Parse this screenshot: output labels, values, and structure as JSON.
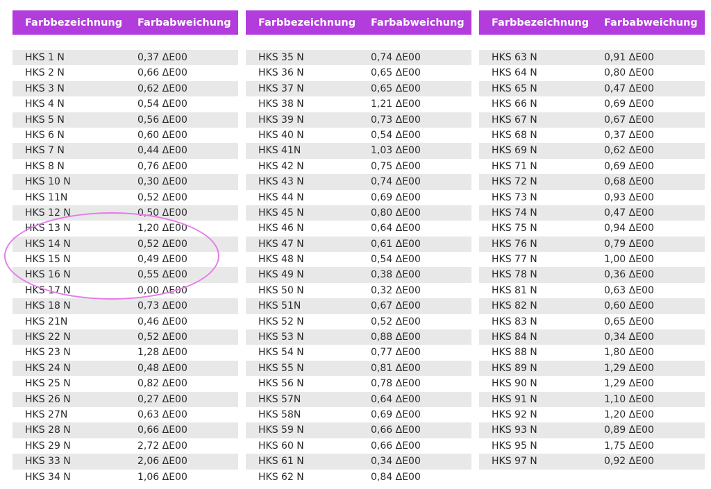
{
  "tables": [
    {
      "header": {
        "name": "Farbbezeichnung",
        "deviation": "Farbabweichung"
      },
      "rows": [
        [
          "HKS 1 N",
          "0,37 ΔE00"
        ],
        [
          "HKS 2 N",
          "0,66 ΔE00"
        ],
        [
          "HKS 3 N",
          "0,62 ΔE00"
        ],
        [
          "HKS 4 N",
          "0,54 ΔE00"
        ],
        [
          "HKS 5 N",
          "0,56 ΔE00"
        ],
        [
          "HKS 6 N",
          "0,60 ΔE00"
        ],
        [
          "HKS 7 N",
          "0,44 ΔE00"
        ],
        [
          "HKS 8 N",
          "0,76 ΔE00"
        ],
        [
          "HKS 10 N",
          "0,30 ΔE00"
        ],
        [
          "HKS 11N",
          "0,52 ΔE00"
        ],
        [
          "HKS 12 N",
          "0,50 ΔE00"
        ],
        [
          "HKS 13 N",
          "1,20 ΔE00"
        ],
        [
          "HKS 14 N",
          "0,52 ΔE00"
        ],
        [
          "HKS 15 N",
          "0,49 ΔE00"
        ],
        [
          "HKS 16 N",
          "0,55 ΔE00"
        ],
        [
          "HKS 17 N",
          "0,00 ΔE00"
        ],
        [
          "HKS 18 N",
          "0,73 ΔE00"
        ],
        [
          "HKS 21N",
          "0,46 ΔE00"
        ],
        [
          "HKS 22 N",
          "0,52 ΔE00"
        ],
        [
          "HKS 23 N",
          "1,28 ΔE00"
        ],
        [
          "HKS 24 N",
          "0,48 ΔE00"
        ],
        [
          "HKS 25 N",
          "0,82 ΔE00"
        ],
        [
          "HKS 26 N",
          "0,27 ΔE00"
        ],
        [
          "HKS 27N",
          "0,63 ΔE00"
        ],
        [
          "HKS 28 N",
          "0,66 ΔE00"
        ],
        [
          "HKS 29 N",
          "2,72 ΔE00"
        ],
        [
          "HKS 33 N",
          "2,06 ΔE00"
        ],
        [
          "HKS 34 N",
          "1,06 ΔE00"
        ]
      ]
    },
    {
      "header": {
        "name": "Farbbezeichnung",
        "deviation": "Farbabweichung"
      },
      "rows": [
        [
          "HKS 35 N",
          "0,74 ΔE00"
        ],
        [
          "HKS 36 N",
          "0,65 ΔE00"
        ],
        [
          "HKS 37 N",
          "0,65 ΔE00"
        ],
        [
          "HKS 38 N",
          "1,21 ΔE00"
        ],
        [
          "HKS 39 N",
          "0,73 ΔE00"
        ],
        [
          "HKS 40 N",
          "0,54 ΔE00"
        ],
        [
          "HKS 41N",
          "1,03 ΔE00"
        ],
        [
          "HKS 42 N",
          "0,75 ΔE00"
        ],
        [
          "HKS 43 N",
          "0,74 ΔE00"
        ],
        [
          "HKS 44 N",
          "0,69 ΔE00"
        ],
        [
          "HKS 45 N",
          "0,80 ΔE00"
        ],
        [
          "HKS 46 N",
          "0,64 ΔE00"
        ],
        [
          "HKS 47 N",
          "0,61 ΔE00"
        ],
        [
          "HKS 48 N",
          "0,54 ΔE00"
        ],
        [
          "HKS 49 N",
          "0,38 ΔE00"
        ],
        [
          "HKS 50 N",
          "0,32 ΔE00"
        ],
        [
          "HKS 51N",
          "0,67 ΔE00"
        ],
        [
          "HKS 52 N",
          "0,52 ΔE00"
        ],
        [
          "HKS 53 N",
          "0,88 ΔE00"
        ],
        [
          "HKS 54 N",
          "0,77 ΔE00"
        ],
        [
          "HKS 55 N",
          "0,81 ΔE00"
        ],
        [
          "HKS 56 N",
          "0,78 ΔE00"
        ],
        [
          "HKS 57N",
          "0,64 ΔE00"
        ],
        [
          "HKS 58N",
          "0,69 ΔE00"
        ],
        [
          "HKS 59 N",
          "0,66 ΔE00"
        ],
        [
          "HKS 60 N",
          "0,66 ΔE00"
        ],
        [
          "HKS 61 N",
          "0,34 ΔE00"
        ],
        [
          "HKS 62 N",
          "0,84 ΔE00"
        ]
      ]
    },
    {
      "header": {
        "name": "Farbbezeichnung",
        "deviation": "Farbabweichung"
      },
      "rows": [
        [
          "HKS 63 N",
          "0,91 ΔE00"
        ],
        [
          "HKS 64 N",
          "0,80 ΔE00"
        ],
        [
          "HKS 65 N",
          "0,47 ΔE00"
        ],
        [
          "HKS 66 N",
          "0,69 ΔE00"
        ],
        [
          "HKS 67 N",
          "0,67 ΔE00"
        ],
        [
          "HKS 68 N",
          "0,37 ΔE00"
        ],
        [
          "HKS 69 N",
          "0,62 ΔE00"
        ],
        [
          "HKS 71 N",
          "0,69 ΔE00"
        ],
        [
          "HKS 72 N",
          "0,68 ΔE00"
        ],
        [
          "HKS 73 N",
          "0,93 ΔE00"
        ],
        [
          "HKS 74 N",
          "0,47 ΔE00"
        ],
        [
          "HKS 75 N",
          "0,94 ΔE00"
        ],
        [
          "HKS 76 N",
          "0,79 ΔE00"
        ],
        [
          "HKS 77 N",
          "1,00 ΔE00"
        ],
        [
          "HKS 78 N",
          "0,36 ΔE00"
        ],
        [
          "HKS 81 N",
          "0,63 ΔE00"
        ],
        [
          "HKS 82 N",
          "0,60 ΔE00"
        ],
        [
          "HKS 83 N",
          "0,65 ΔE00"
        ],
        [
          "HKS 84 N",
          "0,34 ΔE00"
        ],
        [
          "HKS 88 N",
          "1,80 ΔE00"
        ],
        [
          "HKS 89 N",
          "1,29 ΔE00"
        ],
        [
          "HKS 90 N",
          "1,29 ΔE00"
        ],
        [
          "HKS 91 N",
          "1,10 ΔE00"
        ],
        [
          "HKS 92 N",
          "1,20 ΔE00"
        ],
        [
          "HKS 93 N",
          "0,89 ΔE00"
        ],
        [
          "HKS 95 N",
          "1,75 ΔE00"
        ],
        [
          "HKS 97 N",
          "0,92 ΔE00"
        ]
      ]
    }
  ],
  "colors": {
    "header_bg": "#b23cdc",
    "row_alt_bg": "#e8e8e8",
    "highlight": "#e57ae8"
  }
}
